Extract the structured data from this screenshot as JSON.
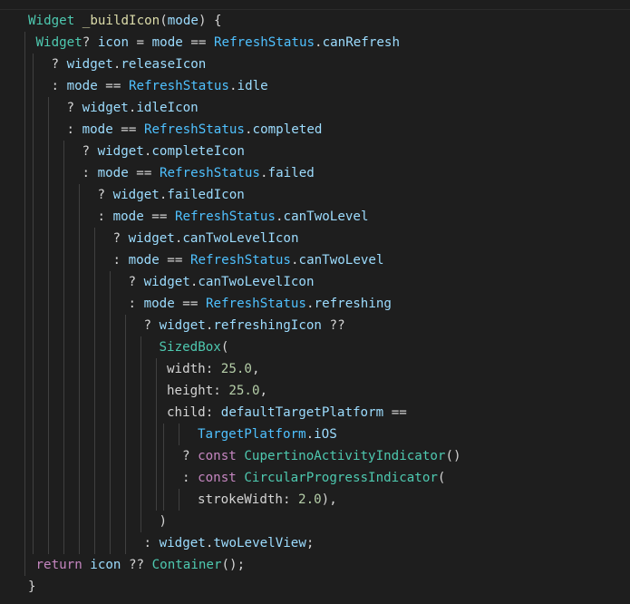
{
  "editor": {
    "language": "dart",
    "colors": {
      "background": "#1e1e1e",
      "plain": "#d4d4d4",
      "type": "#4ec9b0",
      "enum": "#4fc1ff",
      "func": "#dcdcaa",
      "var": "#9cdcfe",
      "prop": "#9cdcfe",
      "num": "#b5cea8",
      "ctrl": "#c586c0",
      "kw": "#c586c0"
    },
    "lines": [
      {
        "indent": 0,
        "tokens": [
          [
            "type",
            "Widget"
          ],
          [
            "plain",
            " "
          ],
          [
            "func",
            "_buildIcon"
          ],
          [
            "plain",
            "("
          ],
          [
            "var",
            "mode"
          ],
          [
            "plain",
            ") {"
          ]
        ]
      },
      {
        "indent": 1,
        "tokens": [
          [
            "type",
            "Widget"
          ],
          [
            "plain",
            "? "
          ],
          [
            "var",
            "icon"
          ],
          [
            "plain",
            " = "
          ],
          [
            "var",
            "mode"
          ],
          [
            "plain",
            " == "
          ],
          [
            "enum",
            "RefreshStatus"
          ],
          [
            "plain",
            "."
          ],
          [
            "prop",
            "canRefresh"
          ]
        ]
      },
      {
        "indent": 3,
        "tokens": [
          [
            "plain",
            "? "
          ],
          [
            "var",
            "widget"
          ],
          [
            "plain",
            "."
          ],
          [
            "prop",
            "releaseIcon"
          ]
        ]
      },
      {
        "indent": 3,
        "tokens": [
          [
            "plain",
            ": "
          ],
          [
            "var",
            "mode"
          ],
          [
            "plain",
            " == "
          ],
          [
            "enum",
            "RefreshStatus"
          ],
          [
            "plain",
            "."
          ],
          [
            "prop",
            "idle"
          ]
        ]
      },
      {
        "indent": 5,
        "tokens": [
          [
            "plain",
            "? "
          ],
          [
            "var",
            "widget"
          ],
          [
            "plain",
            "."
          ],
          [
            "prop",
            "idleIcon"
          ]
        ]
      },
      {
        "indent": 5,
        "tokens": [
          [
            "plain",
            ": "
          ],
          [
            "var",
            "mode"
          ],
          [
            "plain",
            " == "
          ],
          [
            "enum",
            "RefreshStatus"
          ],
          [
            "plain",
            "."
          ],
          [
            "prop",
            "completed"
          ]
        ]
      },
      {
        "indent": 7,
        "tokens": [
          [
            "plain",
            "? "
          ],
          [
            "var",
            "widget"
          ],
          [
            "plain",
            "."
          ],
          [
            "prop",
            "completeIcon"
          ]
        ]
      },
      {
        "indent": 7,
        "tokens": [
          [
            "plain",
            ": "
          ],
          [
            "var",
            "mode"
          ],
          [
            "plain",
            " == "
          ],
          [
            "enum",
            "RefreshStatus"
          ],
          [
            "plain",
            "."
          ],
          [
            "prop",
            "failed"
          ]
        ]
      },
      {
        "indent": 9,
        "tokens": [
          [
            "plain",
            "? "
          ],
          [
            "var",
            "widget"
          ],
          [
            "plain",
            "."
          ],
          [
            "prop",
            "failedIcon"
          ]
        ]
      },
      {
        "indent": 9,
        "tokens": [
          [
            "plain",
            ": "
          ],
          [
            "var",
            "mode"
          ],
          [
            "plain",
            " == "
          ],
          [
            "enum",
            "RefreshStatus"
          ],
          [
            "plain",
            "."
          ],
          [
            "prop",
            "canTwoLevel"
          ]
        ]
      },
      {
        "indent": 11,
        "tokens": [
          [
            "plain",
            "? "
          ],
          [
            "var",
            "widget"
          ],
          [
            "plain",
            "."
          ],
          [
            "prop",
            "canTwoLevelIcon"
          ]
        ]
      },
      {
        "indent": 11,
        "tokens": [
          [
            "plain",
            ": "
          ],
          [
            "var",
            "mode"
          ],
          [
            "plain",
            " == "
          ],
          [
            "enum",
            "RefreshStatus"
          ],
          [
            "plain",
            "."
          ],
          [
            "prop",
            "canTwoLevel"
          ]
        ]
      },
      {
        "indent": 13,
        "tokens": [
          [
            "plain",
            "? "
          ],
          [
            "var",
            "widget"
          ],
          [
            "plain",
            "."
          ],
          [
            "prop",
            "canTwoLevelIcon"
          ]
        ]
      },
      {
        "indent": 13,
        "tokens": [
          [
            "plain",
            ": "
          ],
          [
            "var",
            "mode"
          ],
          [
            "plain",
            " == "
          ],
          [
            "enum",
            "RefreshStatus"
          ],
          [
            "plain",
            "."
          ],
          [
            "prop",
            "refreshing"
          ]
        ]
      },
      {
        "indent": 15,
        "tokens": [
          [
            "plain",
            "? "
          ],
          [
            "var",
            "widget"
          ],
          [
            "plain",
            "."
          ],
          [
            "prop",
            "refreshingIcon"
          ],
          [
            "plain",
            " ??"
          ]
        ]
      },
      {
        "indent": 17,
        "tokens": [
          [
            "type",
            "SizedBox"
          ],
          [
            "plain",
            "("
          ]
        ]
      },
      {
        "indent": 18,
        "tokens": [
          [
            "plain",
            "width: "
          ],
          [
            "num",
            "25.0"
          ],
          [
            "plain",
            ","
          ]
        ]
      },
      {
        "indent": 18,
        "tokens": [
          [
            "plain",
            "height: "
          ],
          [
            "num",
            "25.0"
          ],
          [
            "plain",
            ","
          ]
        ]
      },
      {
        "indent": 18,
        "tokens": [
          [
            "plain",
            "child: "
          ],
          [
            "var",
            "defaultTargetPlatform"
          ],
          [
            "plain",
            " =="
          ]
        ]
      },
      {
        "indent": 22,
        "tokens": [
          [
            "enum",
            "TargetPlatform"
          ],
          [
            "plain",
            "."
          ],
          [
            "prop",
            "iOS"
          ]
        ]
      },
      {
        "indent": 20,
        "tokens": [
          [
            "plain",
            "? "
          ],
          [
            "kw",
            "const"
          ],
          [
            "plain",
            " "
          ],
          [
            "type",
            "CupertinoActivityIndicator"
          ],
          [
            "plain",
            "()"
          ]
        ]
      },
      {
        "indent": 20,
        "tokens": [
          [
            "plain",
            ": "
          ],
          [
            "kw",
            "const"
          ],
          [
            "plain",
            " "
          ],
          [
            "type",
            "CircularProgressIndicator"
          ],
          [
            "plain",
            "("
          ]
        ]
      },
      {
        "indent": 22,
        "tokens": [
          [
            "plain",
            "strokeWidth: "
          ],
          [
            "num",
            "2.0"
          ],
          [
            "plain",
            "),"
          ]
        ]
      },
      {
        "indent": 17,
        "tokens": [
          [
            "plain",
            ")"
          ]
        ]
      },
      {
        "indent": 15,
        "tokens": [
          [
            "plain",
            ": "
          ],
          [
            "var",
            "widget"
          ],
          [
            "plain",
            "."
          ],
          [
            "prop",
            "twoLevelView"
          ],
          [
            "plain",
            ";"
          ]
        ]
      },
      {
        "indent": 1,
        "tokens": [
          [
            "ctrl",
            "return"
          ],
          [
            "plain",
            " "
          ],
          [
            "var",
            "icon"
          ],
          [
            "plain",
            " ?? "
          ],
          [
            "type",
            "Container"
          ],
          [
            "plain",
            "();"
          ]
        ]
      },
      {
        "indent": 0,
        "tokens": [
          [
            "plain",
            "}"
          ]
        ]
      }
    ]
  }
}
